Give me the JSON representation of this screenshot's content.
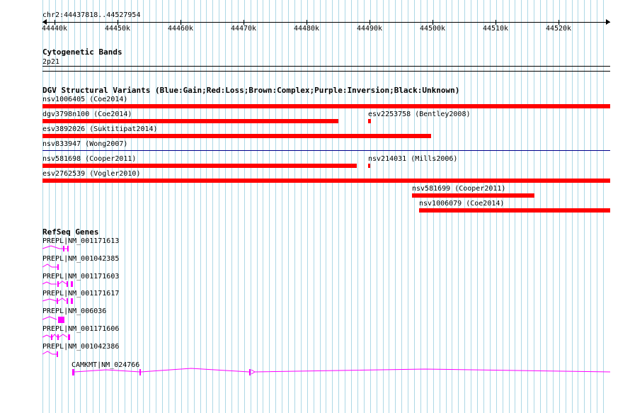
{
  "header": {
    "locus": "chr2:44437818..44527954",
    "ruler_ticks": [
      "44440k",
      "44450k",
      "44460k",
      "44470k",
      "44480k",
      "44490k",
      "44500k",
      "44510k",
      "44520k"
    ]
  },
  "tracks": {
    "cyto": {
      "title": "Cytogenetic Bands",
      "band": "2p21"
    },
    "dgv": {
      "title": "DGV Structural Variants (Blue:Gain;Red:Loss;Brown:Complex;Purple:Inversion;Black:Unknown)",
      "color": "#ff0000",
      "variants": [
        {
          "label": "nsv1006405 (Coe2014)"
        },
        {
          "label": "dgv3798n100 (Coe2014)"
        },
        {
          "label": "esv2253758 (Bentley2008)"
        },
        {
          "label": "esv3892026 (Suktitipat2014)"
        },
        {
          "label": "nsv833947 (Wong2007)"
        },
        {
          "label": "nsv581698 (Cooper2011)"
        },
        {
          "label": "nsv214031 (Mills2006)"
        },
        {
          "label": "esv2762539 (Vogler2010)"
        },
        {
          "label": "nsv581699 (Cooper2011)"
        },
        {
          "label": "nsv1006079 (Coe2014)"
        }
      ]
    },
    "refseq": {
      "title": "RefSeq Genes",
      "color": "#ff00ff",
      "genes": [
        {
          "label": "PREPL|NM_001171613"
        },
        {
          "label": "PREPL|NM_001042385"
        },
        {
          "label": "PREPL|NM_001171603"
        },
        {
          "label": "PREPL|NM_001171617"
        },
        {
          "label": "PREPL|NM_006036"
        },
        {
          "label": "PREPL|NM_001171606"
        },
        {
          "label": "PREPL|NM_001042386"
        },
        {
          "label": "CAMKMT|NM_024766"
        }
      ]
    }
  },
  "colors": {
    "grid": "#add8e6",
    "loss": "#ff0000",
    "gene": "#ff00ff",
    "divider": "#00008b"
  }
}
